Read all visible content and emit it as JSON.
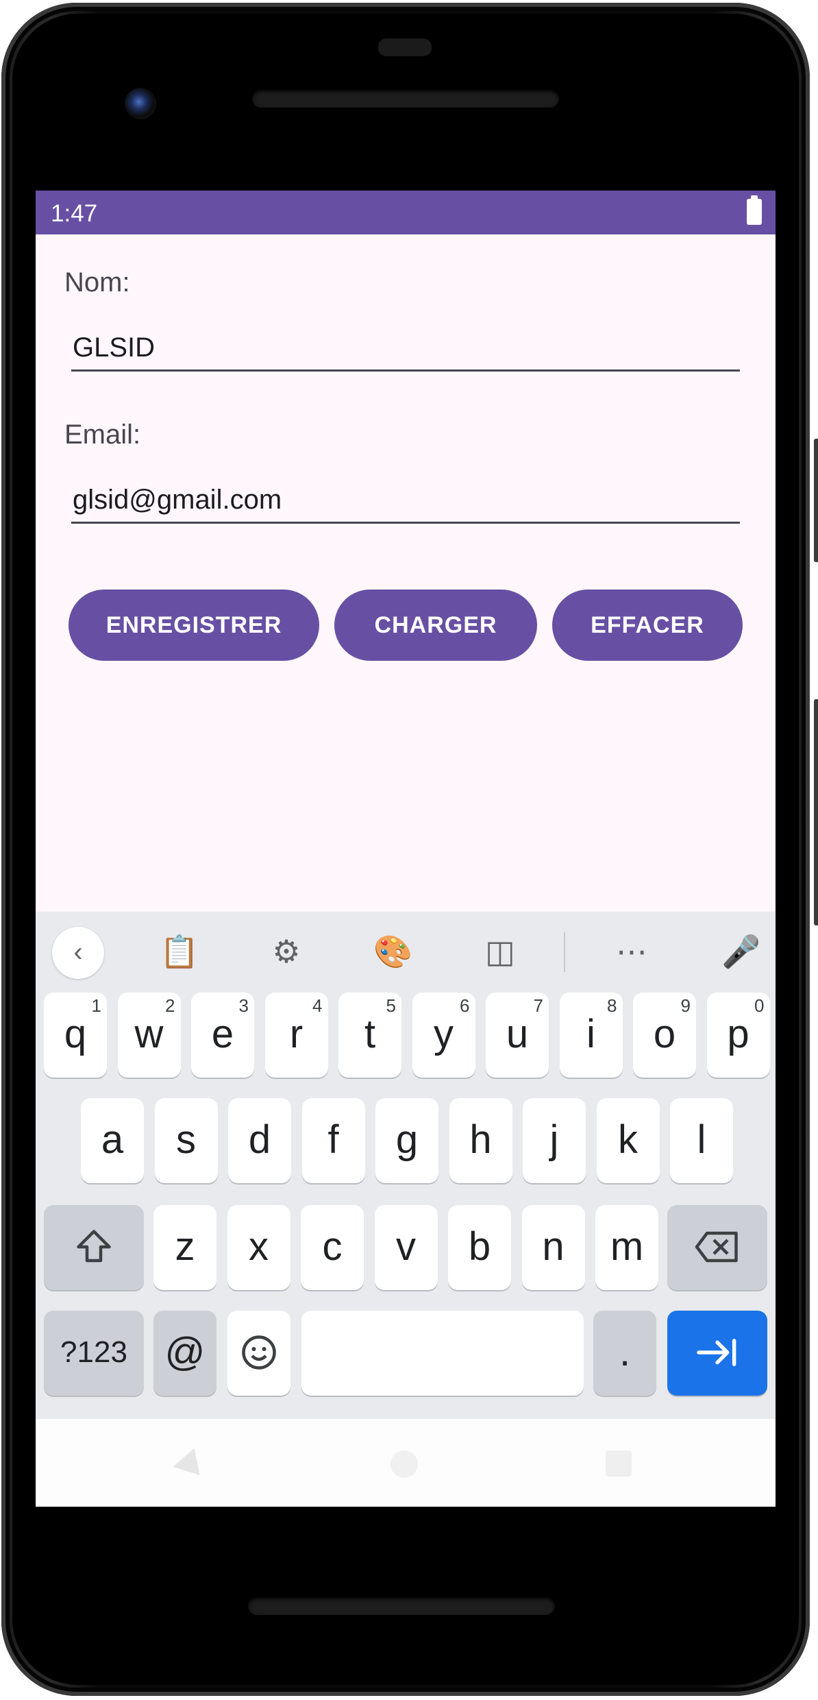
{
  "status_bar": {
    "time": "1:47",
    "battery_icon": "battery-full-icon"
  },
  "form": {
    "name_label": "Nom:",
    "name_value": "GLSID",
    "email_label": "Email:",
    "email_value": "glsid@gmail.com"
  },
  "buttons": {
    "save": "ENREGISTRER",
    "load": "CHARGER",
    "clear": "EFFACER"
  },
  "colors": {
    "primary": "#6750a4",
    "background": "#fff7fb",
    "keyboard_bg": "#e8eaed",
    "accent_key": "#1a73e8"
  },
  "keyboard": {
    "toolbar_icons": [
      "chevron-left-icon",
      "clipboard-icon",
      "gear-icon",
      "palette-icon",
      "floating-keyboard-icon",
      "more-icon",
      "mic-off-icon"
    ],
    "row1": [
      {
        "k": "q",
        "n": "1"
      },
      {
        "k": "w",
        "n": "2"
      },
      {
        "k": "e",
        "n": "3"
      },
      {
        "k": "r",
        "n": "4"
      },
      {
        "k": "t",
        "n": "5"
      },
      {
        "k": "y",
        "n": "6"
      },
      {
        "k": "u",
        "n": "7"
      },
      {
        "k": "i",
        "n": "8"
      },
      {
        "k": "o",
        "n": "9"
      },
      {
        "k": "p",
        "n": "0"
      }
    ],
    "row2": [
      "a",
      "s",
      "d",
      "f",
      "g",
      "h",
      "j",
      "k",
      "l"
    ],
    "row3": [
      "z",
      "x",
      "c",
      "v",
      "b",
      "n",
      "m"
    ],
    "symbols_key": "?123",
    "at_key": "@",
    "period_key": "."
  }
}
